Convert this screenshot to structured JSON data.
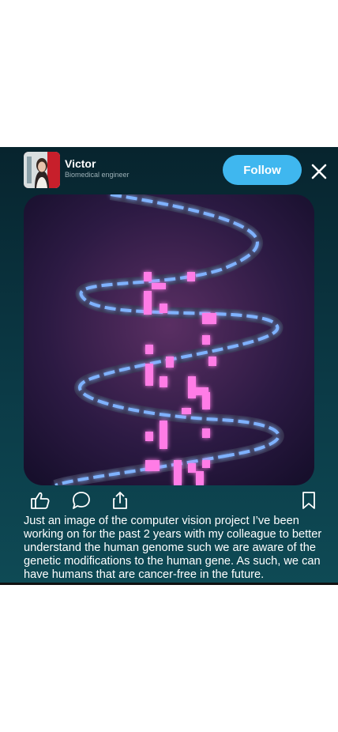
{
  "post": {
    "author_name": "Victor",
    "author_title": "Biomedical engineer",
    "follow_label": "Follow",
    "caption": "Just an image of the computer vision project I’ve been working on for the past 2 years with my colleague to better understand the human genome such we are aware of the genetic modifications to the human gene. As such, we can have humans that are cancer-free in the future."
  },
  "icons": {
    "avatar": "profile-photo",
    "close": "close-icon",
    "like": "thumbs-up-icon",
    "comment": "chat-bubble-icon",
    "share": "share-icon",
    "bookmark": "bookmark-icon"
  },
  "colors": {
    "follow_button": "#3fb7ef",
    "card_background": "#0b3a46",
    "glow_pink": "#ff66e0",
    "glow_blue": "#7fb2ff"
  }
}
